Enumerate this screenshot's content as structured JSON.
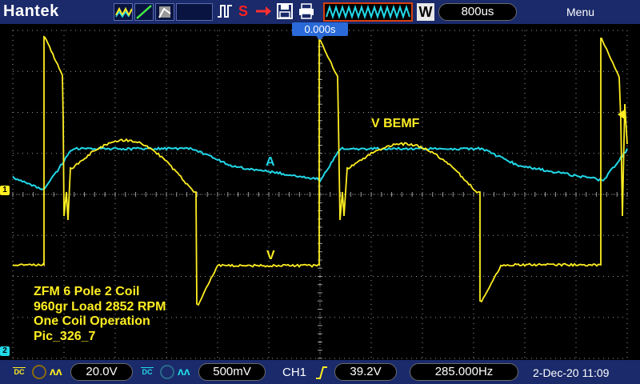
{
  "brand": "Hantek",
  "topbar": {
    "stop_glyph": "S",
    "timebase": "800us",
    "w_label": "W",
    "menu_label": "Menu"
  },
  "screen": {
    "trigger_time": "0.000s",
    "ch1_marker": "1",
    "ch2_marker": "2",
    "labels": {
      "bemf": "V BEMF",
      "current": "A",
      "voltage": "V"
    },
    "notes": [
      "ZFM 6 Pole 2 Coil",
      "960gr Load 2852 RPM",
      "One Coil Operation",
      "Pic_326_7"
    ]
  },
  "bottombar": {
    "ch1_coupling": "DC",
    "ch1_scale": "20.0V",
    "ch2_coupling": "DC",
    "ch2_scale": "500mV",
    "trigger_source": "CH1",
    "trigger_level": "39.2V",
    "frequency": "285.000Hz",
    "datetime": "2-Dec-20 11:09"
  },
  "colors": {
    "ch1": "#ffee22",
    "ch2": "#22d8e8",
    "bar": "#1a2a6a",
    "grid": "#9a9a9a"
  }
}
